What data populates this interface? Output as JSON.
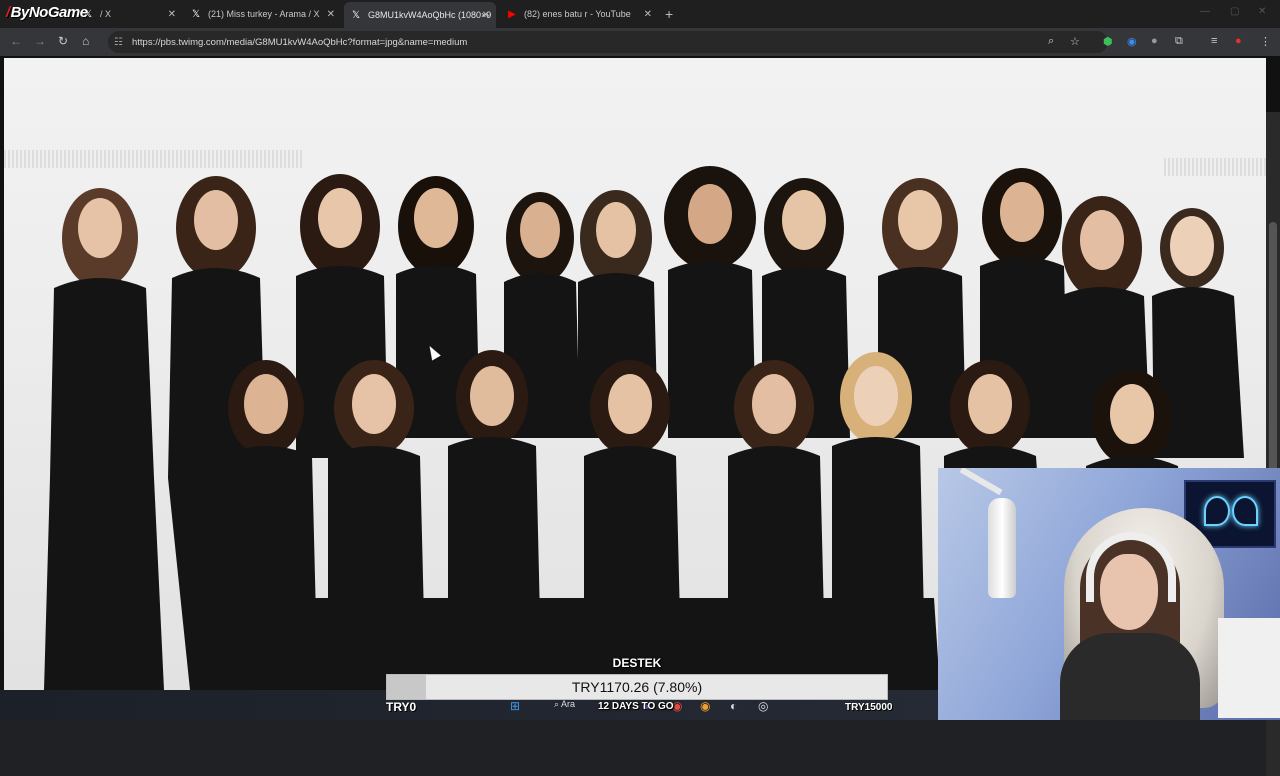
{
  "brand_overlay": {
    "logo_text": "ByNoGame"
  },
  "tabs": [
    {
      "label": "/ X",
      "icon": "x-logo-icon",
      "active": false
    },
    {
      "label": "(21) Miss turkey - Arama / X",
      "icon": "x-logo-icon",
      "active": false
    },
    {
      "label": "G8MU1kvW4AoQbHc (1080×9",
      "icon": "x-logo-icon",
      "active": true
    },
    {
      "label": "(82) enes batu r - YouTube",
      "icon": "youtube-icon",
      "active": false
    }
  ],
  "address_bar": {
    "url": "https://pbs.twimg.com/media/G8MU1kvW4AoQbHc?format=jpg&name=medium"
  },
  "stream_overlay": {
    "donation_title": "DESTEK",
    "donation_amount": "TRY1170.26 (7.80%)",
    "donation_progress": 0.078,
    "goal_start": "TRY0",
    "goal_end": "TRY15000",
    "countdown": "12 DAYS TO GO"
  },
  "taskbar": {
    "search_label": "Ara"
  },
  "colors": {
    "browser_bg": "#202124",
    "tab_active": "#35363a",
    "photo_bg": "#efefef",
    "webcam_bg": "#8ea5d8"
  }
}
